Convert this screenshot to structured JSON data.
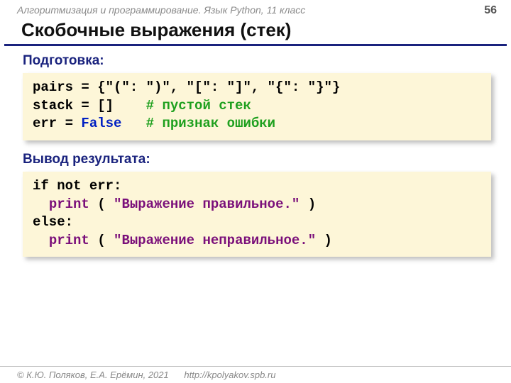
{
  "header": {
    "course": "Алгоритмизация и программирование. Язык Python, 11 класс",
    "page": "56"
  },
  "title": "Скобочные выражения (стек)",
  "sections": {
    "prep_label": "Подготовка:",
    "out_label": "Вывод результата:"
  },
  "code1": {
    "l1": "pairs = {\"(\": \")\", \"[\": \"]\", \"{\": \"}\"}",
    "l2a": "stack = []    ",
    "l2b": "# пустой стек",
    "l3a": "err = ",
    "l3b": "False",
    "l3c": "   ",
    "l3d": "# признак ошибки"
  },
  "code2": {
    "l1a": "if",
    "l1b": " ",
    "l1c": "not",
    "l1d": " err:",
    "l2a": "  ",
    "l2b": "print",
    "l2c": " ( ",
    "l2d": "\"Выражение правильное.\"",
    "l2e": " )",
    "l3a": "else",
    "l3b": ":",
    "l4a": "  ",
    "l4b": "print",
    "l4c": " ( ",
    "l4d": "\"Выражение неправильное.\"",
    "l4e": " )"
  },
  "footer": {
    "copyright": "© К.Ю. Поляков, Е.А. Ерёмин, 2021",
    "url": "http://kpolyakov.spb.ru"
  }
}
